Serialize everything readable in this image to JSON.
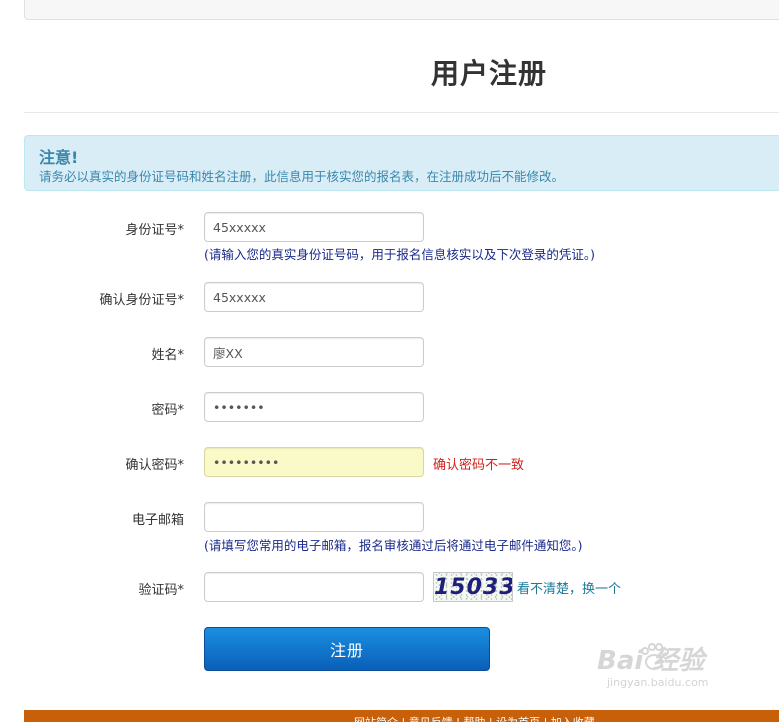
{
  "page": {
    "title": "用户注册"
  },
  "alert": {
    "title": "注意!",
    "text": "请务必以真实的身份证号码和姓名注册，此信息用于核实您的报名表，在注册成功后不能修改。"
  },
  "form": {
    "id_number": {
      "label": "身份证号*",
      "value": "45xxxxx",
      "hint": "(请输入您的真实身份证号码，用于报名信息核实以及下次登录的凭证。)"
    },
    "confirm_id": {
      "label": "确认身份证号*",
      "value": "45xxxxx"
    },
    "name": {
      "label": "姓名*",
      "value": "廖XX"
    },
    "password": {
      "label": "密码*",
      "value": "•••••••"
    },
    "confirm_password": {
      "label": "确认密码*",
      "value": "•••••••••",
      "error": "确认密码不一致"
    },
    "email": {
      "label": "电子邮箱",
      "value": "",
      "hint": "(请填写您常用的电子邮箱，报名审核通过后将通过电子邮件通知您。)"
    },
    "captcha": {
      "label": "验证码*",
      "value": "",
      "image_text": "15033",
      "refresh": "看不清楚，换一个"
    },
    "submit_label": "注册"
  },
  "footer": {
    "links": "网站简介 | 意见反馈 | 帮助 | 设为首页 | 加入收藏"
  },
  "watermark": {
    "logo": "Bai 经验",
    "sub": "jingyan.baidu.com"
  }
}
